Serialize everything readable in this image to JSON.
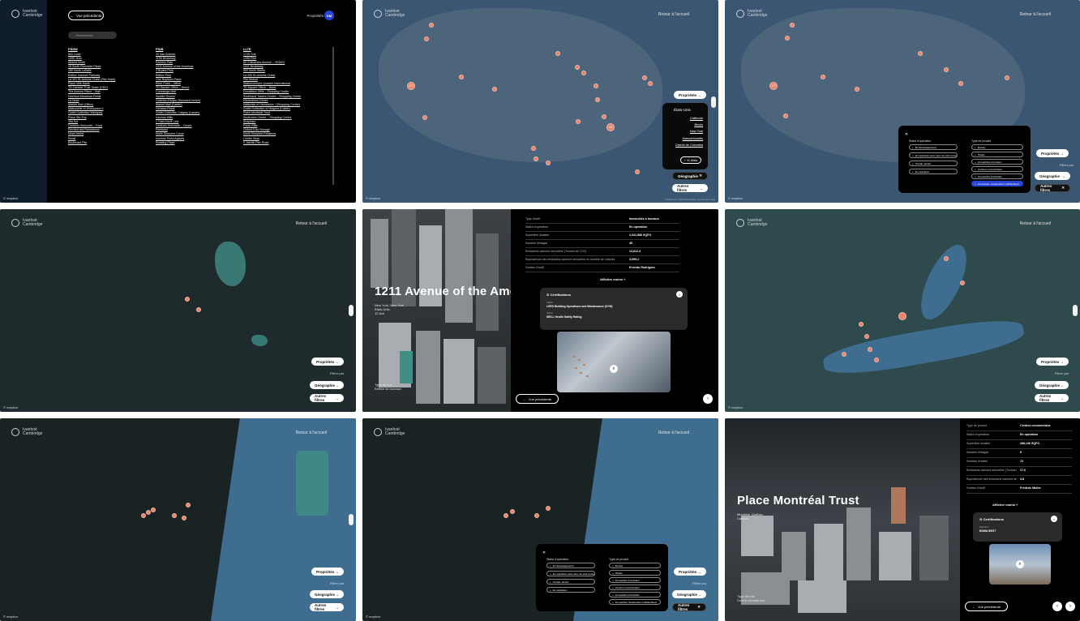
{
  "brand": {
    "logo_line1": "Ivanhoé",
    "logo_line2": "Cambridge",
    "mapbox": "© mapbox",
    "attribution": "© Mapbox © OpenStreetMap Improve this map"
  },
  "nav": {
    "back_home": "Retour à l'accueil",
    "back_prev": "Vue précédente",
    "prev_button": "Vue précédente"
  },
  "header": {
    "proprietes": "Propriétés",
    "avatar": "KM"
  },
  "search": {
    "placeholder": "Rechercher"
  },
  "filters": {
    "proprietes": "Propriétés",
    "filtrer_par": "Filtrer par",
    "geographie": "Géographie",
    "autres_filtres": "Autres filtres"
  },
  "property_list": {
    "columns": [
      {
        "header": "PSDM",
        "items": [
          "800 Lowe",
          "1395 Jean",
          "Atlanta North",
          "18 South Riverside Plaza",
          "180 North LaSalle",
          "Édifice Ivanhoé Parkway",
          "La 401 St-Antoine Ouest (Ritz Hotel)",
          "Place Ville Marie",
          "TD Canada Trust Tower (CED)",
          "The Avenue Place – Mall",
          "Deerfoot Meadows Retail",
          "La Nova",
          "Market Mall (Office)",
          "Maisonette et Workspace II",
          "Outlet Collection Winnipeg",
          "Place Ste-Foy",
          "Vila Sol",
          "Centurio Horizonte – Food",
          "Ferreira dos Ramalanos",
          "Nova Ixmira",
          "Retail",
          "Boulevard Pila"
        ]
      },
      {
        "header": "PSIB",
        "items": [
          "20 San Antonio",
          "1155 Broadway",
          "Eachley Park",
          "1211 Avenue of the Americas",
          "3 Bryant Park",
          "Édifice Prim",
          "One Boylston Place",
          "River Point – Office",
          "TD Square Office – Demo",
          "Conestoga Mall",
          "Saddle Shores",
          "Galeries d'Anjou (Brossard centre)",
          "Market Mall (Calder)",
          "Oshawa Retail",
          "Outlet Collection Calgary (Lander)",
          "Ivanhoé Mills",
          "1 Train North Link",
          "Centurio Horizonte – Condo",
          "Parkwest",
          "North Shorpine Canal",
          "Ivanhoé Porta Agaves",
          "Rotating Plaza"
        ]
      },
      {
        "header": "LLTE",
        "items": [
          "1725 Tork",
          "1255 Peel",
          "60 Grandview Avenue – SEDEV",
          "1411 Broadway",
          "500 North Steele",
          "La 405 St-Antoine Ouest",
          "Pile Mutual",
          "Stationnement Quartier International",
          "TD Square Office – Norte",
          "Donaldson Mills – Shopping Center",
          "Southland Towers Center – Shopping Centre",
          "Dimensions Centre",
          "Nationale et Hamarstoe I (Shopping Center)",
          "Outlet Collection of Niagara (Calder)",
          "Place Montréal Trust",
          "Southview Centre – Shopping Centre",
          "Shapham",
          "Porta Vitlla",
          "Oxford Cold Storage",
          "North Shorpine Fortaleza",
          "Centre Vista",
          "9 Jasmin Pier Road"
        ]
      }
    ]
  },
  "us_states": {
    "title": "États-Unis",
    "items": [
      "Californie",
      "Illinois",
      "New York",
      "Massachusetts",
      "District de Columbia"
    ],
    "more": "+ 11 états"
  },
  "filter_popup": {
    "statut_title": "Statut d'opération",
    "statut_options": [
      "En développement",
      "En opération avec taux de prêt consenti",
      "Terrain vacant",
      "En opération"
    ],
    "type_title": "Type de produit",
    "type_options": [
      "Écoles",
      "Hôtels",
      "Immeubles à bureaux",
      "Centres commerciaux",
      "Immeubles industriels",
      "Immeubles résidentiels multifamiliaux"
    ]
  },
  "building_1211": {
    "name": "1211 Avenue of the Americas",
    "address_line1": "New York, New York",
    "address_line2": "États-Unis",
    "address_line3": "12 Ave",
    "footer_label": "Type de vue",
    "footer_value": "Édifice de bureaux",
    "rows": [
      {
        "k": "Type d'actif",
        "v": "Immeubles à bureaux"
      },
      {
        "k": "Statut d'opération",
        "v": "En opération"
      },
      {
        "k": "Superficie locative",
        "v": "2,041,580 SQFO"
      },
      {
        "k": "Nombre d'étages",
        "v": "45"
      },
      {
        "k": "Émissions carbone annuelles (Tonnes de CO2)",
        "v": "14,012.3"
      },
      {
        "k": "Équivalence des émissions carbone annuelles en nombre de voitures",
        "v": "3,099.2"
      },
      {
        "k": "Gestion d'actif",
        "v": "Ernesto Rodríguez"
      }
    ],
    "show_more": "Afficher moins",
    "cert_title": "Certifications",
    "cert_items": [
      {
        "label": "LEED",
        "value": "LEED Building Operations and Maintenance (O+M)"
      },
      {
        "label": "Santé",
        "value": "WELL Health Safety Rating"
      }
    ]
  },
  "building_pmt": {
    "name": "Place Montréal Trust",
    "address_line1": "Montréal, Québec",
    "address_line2": "Canada",
    "footer_label": "Type de vue",
    "footer_value": "Centre commercial",
    "rows": [
      {
        "k": "Type de produit",
        "v": "Centres commerciaux"
      },
      {
        "k": "Statut d'opération",
        "v": "En opération"
      },
      {
        "k": "Superficie locative",
        "v": "288,136 SQFO"
      },
      {
        "k": "Nombre d'étages",
        "v": "5"
      },
      {
        "k": "Nombre d'unités",
        "v": "72"
      },
      {
        "k": "Émissions carbone annuelles (Tonnes de CO2)",
        "v": "17.6"
      },
      {
        "k": "Équivalence des émissions carbone annuelles en nombre de voitures",
        "v": "3.8"
      },
      {
        "k": "Gestion d'actif",
        "v": "Frédéric Muller"
      }
    ],
    "show_more": "Afficher moins",
    "cert_title": "Certifications",
    "cert_items": [
      {
        "label": "Platinum",
        "value": "BOMA BEST"
      }
    ]
  },
  "clusters": {
    "west_coast": "177",
    "nyc_cluster": "44",
    "chicago_cluster": "11"
  },
  "colors": {
    "accent_blue": "#2747d6",
    "marker": "#e8846b",
    "water": "#3b5672",
    "land_dark": "#1e2a2b"
  }
}
